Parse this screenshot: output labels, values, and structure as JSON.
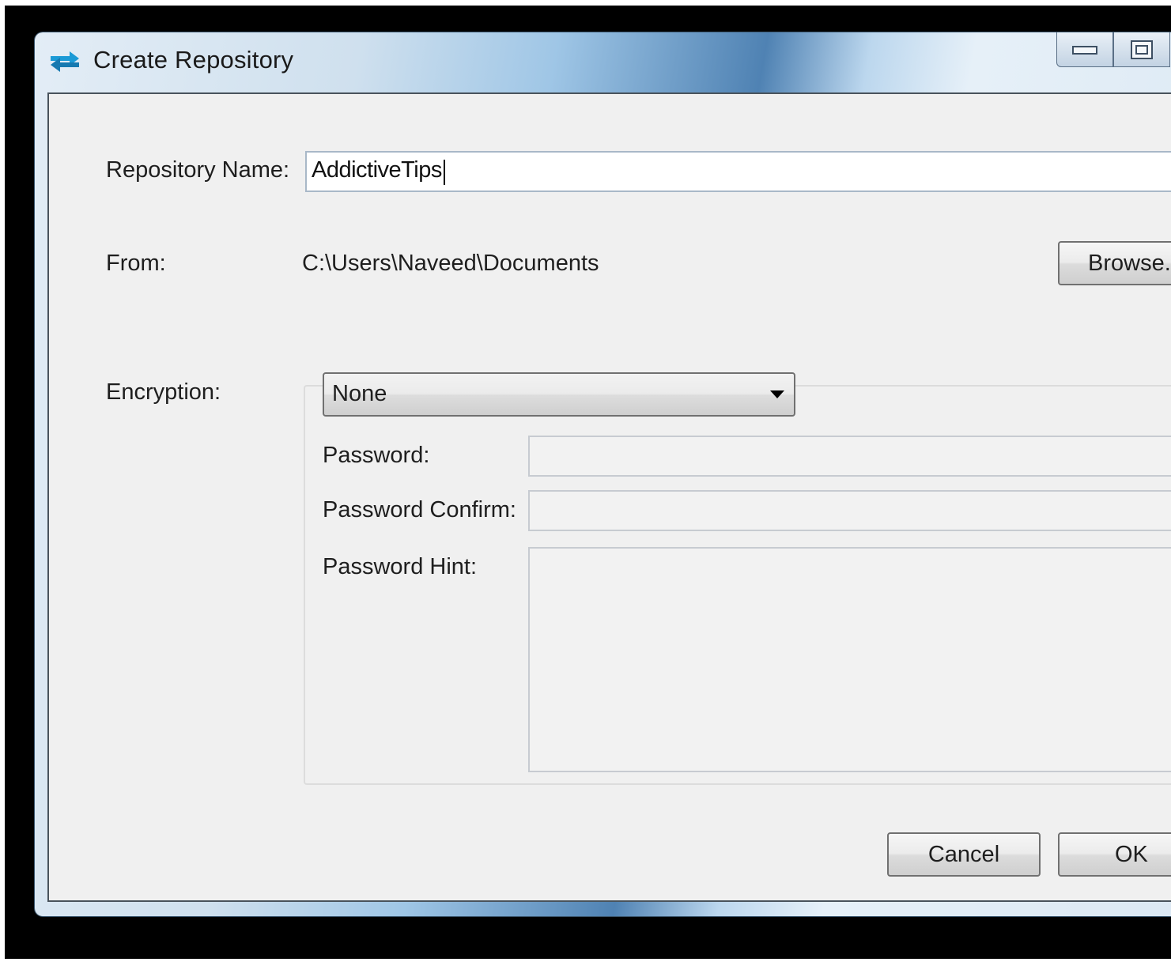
{
  "window": {
    "title": "Create Repository",
    "icon": "sync-arrows-icon"
  },
  "caption_buttons": {
    "minimize_icon": "minimize-icon",
    "maximize_icon": "maximize-icon"
  },
  "form": {
    "repository_name": {
      "label": "Repository Name:",
      "value": "AddictiveTips"
    },
    "from": {
      "label": "From:",
      "path": "C:\\Users\\Naveed\\Documents",
      "browse_label": "Browse..."
    },
    "encryption": {
      "label": "Encryption:",
      "selected": "None",
      "password_label": "Password:",
      "password_value": "",
      "password_confirm_label": "Password Confirm:",
      "password_confirm_value": "",
      "password_hint_label": "Password Hint:",
      "password_hint_value": ""
    }
  },
  "actions": {
    "cancel_label": "Cancel",
    "ok_label": "OK"
  },
  "colors": {
    "dialog_background": "#f0f0f0",
    "titlebar_accent": "#4f82b3",
    "icon_blue": "#1b9ad6"
  }
}
